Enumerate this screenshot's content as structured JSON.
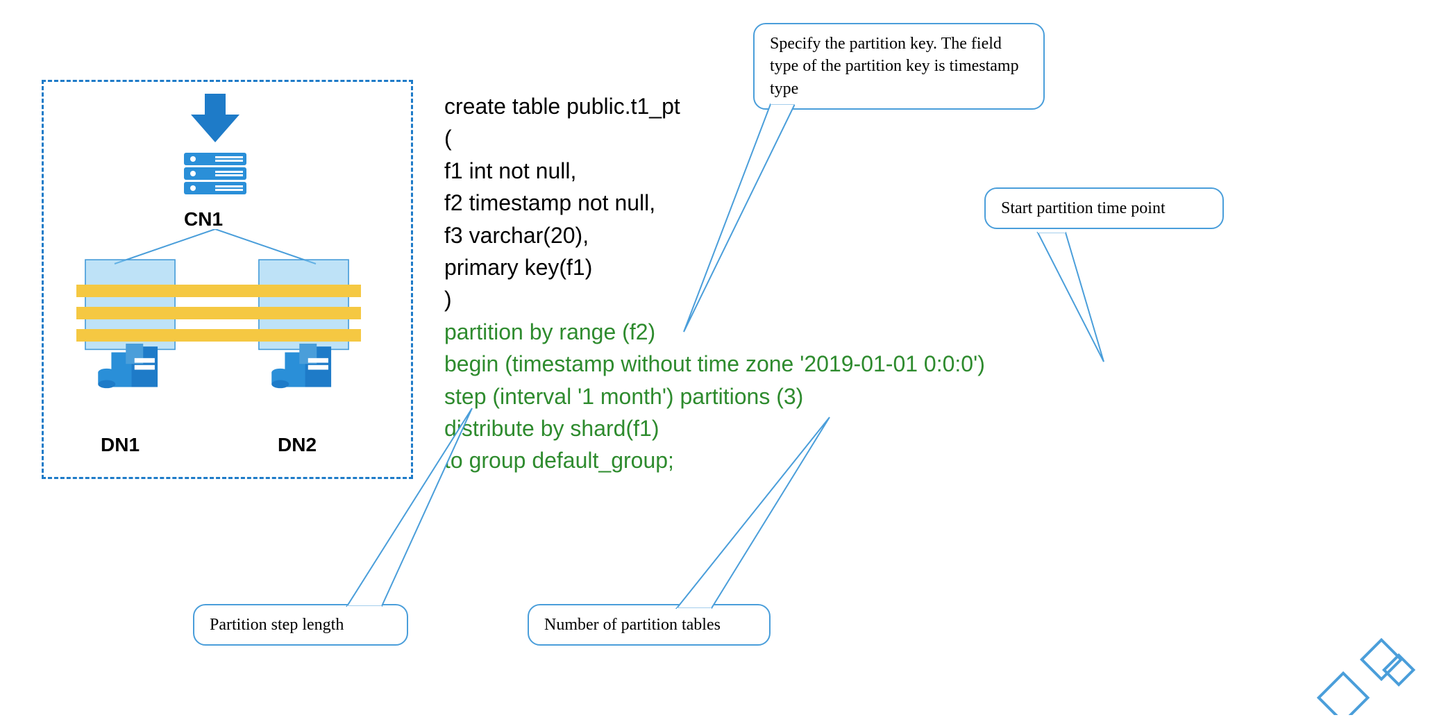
{
  "architecture": {
    "cn_label": "CN1",
    "dn1_label": "DN1",
    "dn2_label": "DN2"
  },
  "code": {
    "line1": "create table public.t1_pt",
    "line2": "(",
    "line3": "f1 int not null,",
    "line4": "f2 timestamp not null,",
    "line5": "f3 varchar(20),",
    "line6": "primary key(f1)",
    "line7": ")",
    "line8": "partition by range (f2)",
    "line9": "begin (timestamp without time zone '2019-01-01 0:0:0')",
    "line10": "step (interval '1 month') partitions (3)",
    "line11": "distribute by shard(f1)",
    "line12": "to group default_group;"
  },
  "callouts": {
    "partition_key": "Specify the partition key. The field type of the partition key is timestamp type",
    "start_time": "Start partition time point",
    "step_length": "Partition step length",
    "num_tables": "Number of partition tables"
  },
  "colors": {
    "blue": "#1e7bc8",
    "lightblue": "#4a9eda",
    "green": "#2e8b2e",
    "yellow": "#f5c842",
    "serverblue": "#2a8fd8"
  }
}
